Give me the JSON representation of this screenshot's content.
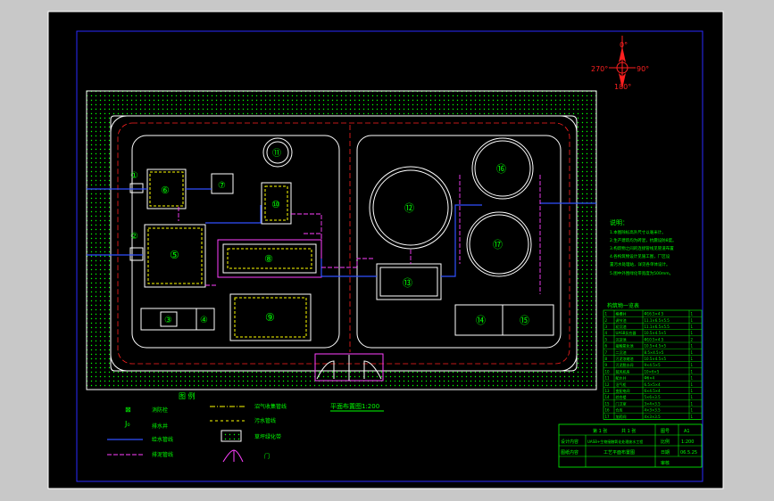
{
  "colors": {
    "outer_bg": "#c8c8c8",
    "sheet_bg": "#000000",
    "frame_white": "#ffffff",
    "frame_blue": "#2a2aff",
    "green": "#00ff00",
    "red": "#ff2020",
    "yellow": "#ffff00",
    "magenta": "#ff40ff",
    "blue_pipe": "#3050ff",
    "cyan": "#00ffff"
  },
  "compass": {
    "n": "0°",
    "e": "90°",
    "s": "180°",
    "w": "270°"
  },
  "units": [
    {
      "id": "u1",
      "label": "①"
    },
    {
      "id": "u2",
      "label": "②"
    },
    {
      "id": "u3",
      "label": "③"
    },
    {
      "id": "u4",
      "label": "④"
    },
    {
      "id": "u5",
      "label": "⑤"
    },
    {
      "id": "u6",
      "label": "⑥"
    },
    {
      "id": "u7",
      "label": "⑦"
    },
    {
      "id": "u8",
      "label": "⑧"
    },
    {
      "id": "u9",
      "label": "⑨"
    },
    {
      "id": "u10",
      "label": "⑩"
    },
    {
      "id": "u11",
      "label": "⑪"
    },
    {
      "id": "u12",
      "label": "⑫"
    },
    {
      "id": "u13",
      "label": "⑬"
    },
    {
      "id": "u14",
      "label": "⑭"
    },
    {
      "id": "u15",
      "label": "⑮"
    },
    {
      "id": "u16",
      "label": "⑯"
    },
    {
      "id": "u17",
      "label": "⑰"
    }
  ],
  "legend": {
    "title": "图 例",
    "items": [
      {
        "label": "消防栓"
      },
      {
        "label": "排水井"
      },
      {
        "label": "给水管线"
      },
      {
        "label": "排泥管线"
      },
      {
        "label": "沼气收集管线"
      },
      {
        "label": "污水管线"
      },
      {
        "label": "草坪绿化带"
      },
      {
        "label": "门"
      }
    ]
  },
  "plan_title": "平面布置图1:200",
  "notes": {
    "title": "说明：",
    "lines": [
      "1.本图除标高外尺寸以毫米计。",
      "2.生产建筑均为砖混，抗震设防8度。",
      "3.构筑物之间的连接管线见管道布置",
      "4.各构筑物设计见施工图，厂区设",
      "  置污水处理站，详见各单体设计。",
      "5.图中外围绿化带宽度为500mm。"
    ]
  },
  "structures_table": {
    "title": "构筑物一览表",
    "rows": [
      {
        "no": "1",
        "name": "格栅井",
        "size": "Φ16.5×4.5",
        "count": "1"
      },
      {
        "no": "2",
        "name": "调节池",
        "size": "11.1×6.5×5.5",
        "count": "1"
      },
      {
        "no": "3",
        "name": "初沉池",
        "size": "11.1×6.5×5.5",
        "count": "1"
      },
      {
        "no": "4",
        "name": "UASB反应器",
        "size": "10.5×4.5×5",
        "count": "1"
      },
      {
        "no": "5",
        "name": "沉淀池",
        "size": "Φ10.5×4.5",
        "count": "2"
      },
      {
        "no": "6",
        "name": "接触氧化池",
        "size": "10.5×4.5×5",
        "count": "1"
      },
      {
        "no": "7",
        "name": "二沉池",
        "size": "8.5×4.5×5",
        "count": "1"
      },
      {
        "no": "8",
        "name": "污泥浓缩池",
        "size": "10.5×4.5×5",
        "count": "1"
      },
      {
        "no": "9",
        "name": "污泥脱水间",
        "size": "9×4.5×5",
        "count": "1"
      },
      {
        "no": "10",
        "name": "鼓风机房",
        "size": "10×6×5",
        "count": "1"
      },
      {
        "no": "11",
        "name": "配水井",
        "size": "Φ6×4",
        "count": "1"
      },
      {
        "no": "12",
        "name": "沼气柜",
        "size": "6.5×5×4",
        "count": "1"
      },
      {
        "no": "13",
        "name": "变配电间",
        "size": "6×4.5×4",
        "count": "1"
      },
      {
        "no": "14",
        "name": "综合楼",
        "size": "5×6×3.5",
        "count": "1"
      },
      {
        "no": "15",
        "name": "门卫室",
        "size": "3×4×3.5",
        "count": "1"
      },
      {
        "no": "16",
        "name": "仓库",
        "size": "4×3×3.5",
        "count": "1"
      },
      {
        "no": "17",
        "name": "加药间",
        "size": "4×3×3.5",
        "count": "1"
      }
    ]
  },
  "title_block": {
    "sheet": "第 1 张",
    "total": "共 1 张",
    "fig_label": "图号",
    "fig_value": "A1",
    "scale_label": "比例",
    "scale_value": "1:200",
    "date_label": "日期",
    "date_value": "06.5.25",
    "design_label": "设计内容",
    "design_value": "UASB+生物接触氧化处理废水工程",
    "drawing_label": "图纸内容",
    "drawing_value": "工艺平面布置图",
    "review_label": "审核"
  }
}
